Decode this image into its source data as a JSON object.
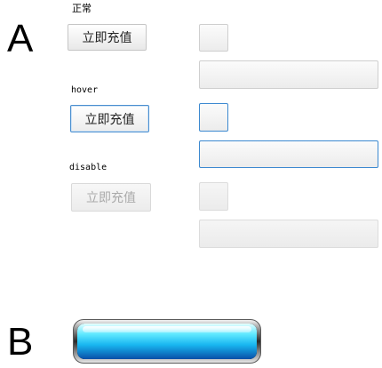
{
  "sections": {
    "a": {
      "letter": "A"
    },
    "b": {
      "letter": "B"
    }
  },
  "states": {
    "normal": {
      "label": "正常",
      "button_label": "立即充值"
    },
    "hover": {
      "label": "hover",
      "button_label": "立即充值"
    },
    "disabled": {
      "label": "disable",
      "button_label": "立即充值"
    }
  },
  "progress": {
    "fill_fraction": 1.0
  },
  "colors": {
    "hover_border": "#3c89d0",
    "disabled_text": "#aaaaaa",
    "progress_fill": "#18b6f0"
  }
}
